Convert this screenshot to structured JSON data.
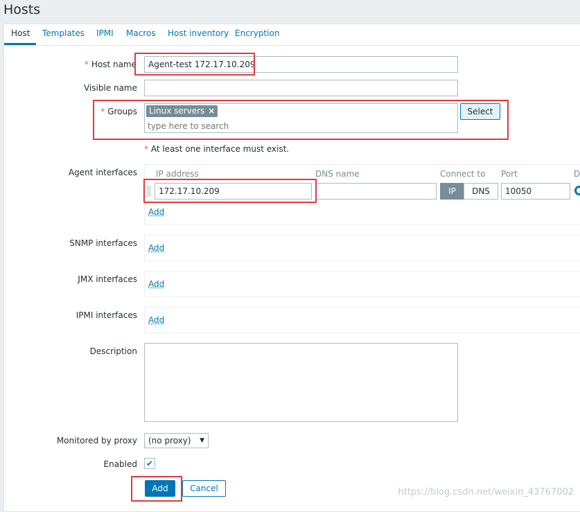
{
  "page": {
    "title": "Hosts"
  },
  "tabs": [
    {
      "label": "Host",
      "active": true
    },
    {
      "label": "Templates"
    },
    {
      "label": "IPMI"
    },
    {
      "label": "Macros"
    },
    {
      "label": "Host inventory"
    },
    {
      "label": "Encryption"
    }
  ],
  "form": {
    "required_mark": "*",
    "host_name": {
      "label": "Host name",
      "value": "Agent-test 172.17.10.209"
    },
    "visible_name": {
      "label": "Visible name",
      "value": ""
    },
    "groups": {
      "label": "Groups",
      "chips": [
        "Linux servers"
      ],
      "chip_remove": "×",
      "placeholder": "type here to search",
      "select_label": "Select"
    },
    "interface_warning": "At least one interface must exist.",
    "agent_interfaces": {
      "label": "Agent interfaces",
      "columns": {
        "ip": "IP address",
        "dns": "DNS name",
        "connect": "Connect to",
        "port": "Port",
        "default": "D"
      },
      "row": {
        "ip": "172.17.10.209",
        "dns": "",
        "connect_ip": "IP",
        "connect_dns": "DNS",
        "port": "10050"
      },
      "add_label": "Add"
    },
    "snmp_interfaces": {
      "label": "SNMP interfaces",
      "add_label": "Add"
    },
    "jmx_interfaces": {
      "label": "JMX interfaces",
      "add_label": "Add"
    },
    "ipmi_interfaces": {
      "label": "IPMI interfaces",
      "add_label": "Add"
    },
    "description": {
      "label": "Description",
      "value": ""
    },
    "proxy": {
      "label": "Monitored by proxy",
      "value": "(no proxy)"
    },
    "enabled": {
      "label": "Enabled",
      "checked": true,
      "check_glyph": "✔"
    }
  },
  "actions": {
    "add_label": "Add",
    "cancel_label": "Cancel"
  },
  "watermark": "https://blog.csdn.net/weixin_43767002",
  "colors": {
    "accent": "#0275b8",
    "highlight": "#e0393e",
    "required": "#e45959"
  }
}
